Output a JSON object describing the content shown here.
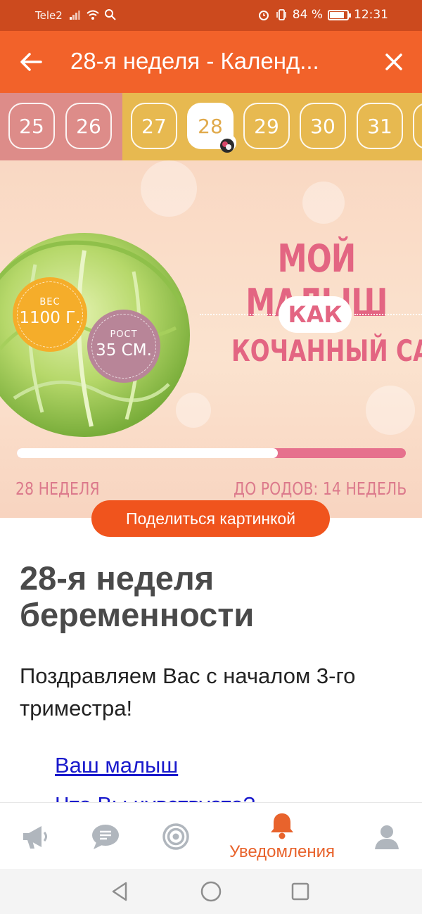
{
  "status_bar": {
    "carrier": "Tele2",
    "battery": "84 %",
    "battery_level": 0.84,
    "time": "12:31"
  },
  "app_bar": {
    "title": "28-я неделя - Календ..."
  },
  "weeks": {
    "items": [
      "25",
      "26",
      "27",
      "28",
      "29",
      "30",
      "31"
    ],
    "current": "28"
  },
  "hero": {
    "line1": "МОЙ МАЛЫШ",
    "line2": "КАК",
    "line3": "КОЧАННЫЙ САЛАТ",
    "weight_label": "ВЕС",
    "weight_value": "1100 Г.",
    "height_label": "РОСТ",
    "height_value": "35 СМ.",
    "progress": 0.67,
    "week_label": "28 НЕДЕЛЯ",
    "remaining_label": "ДО РОДОВ: 14 НЕДЕЛЬ",
    "colors": {
      "pink": "#e36582",
      "orange": "#f5ad2a",
      "mauve": "#b88598"
    }
  },
  "share_button": "Поделиться картинкой",
  "article": {
    "title": "28-я неделя беременности",
    "text": "Поздравляем Вас с началом 3-го триместра!",
    "link": "Ваш малыш",
    "link2": "Что Вы чувствуете?"
  },
  "bottom_nav": {
    "items": [
      {
        "icon": "megaphone-icon",
        "label": ""
      },
      {
        "icon": "chat-icon",
        "label": ""
      },
      {
        "icon": "target-icon",
        "label": ""
      },
      {
        "icon": "bell-icon",
        "label": "Уведомления"
      },
      {
        "icon": "profile-icon",
        "label": ""
      }
    ],
    "active_color": "#e8632c",
    "inactive_color": "#b0b6bd"
  },
  "colors": {
    "status_bar": "#cc4a1e",
    "app_bar": "#f2622a",
    "weeks_bg": "#e7b950",
    "weeks_past_bg": "#dd8c89"
  }
}
